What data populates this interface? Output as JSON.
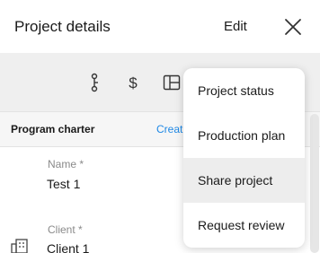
{
  "header": {
    "title": "Project details",
    "edit_label": "Edit",
    "close_icon": "close-icon"
  },
  "toolbar": {
    "icons": [
      "timeline-icon",
      "dollar-icon",
      "layout-icon"
    ]
  },
  "section": {
    "title": "Program charter",
    "link": "Creat"
  },
  "fields": [
    {
      "label": "Name *",
      "value": "Test 1"
    },
    {
      "label": "Client *",
      "value": "Client 1"
    }
  ],
  "menu": {
    "items": [
      "Project status",
      "Production plan",
      "Share project",
      "Request review"
    ],
    "active_item": "Share project"
  },
  "colors": {
    "link": "#1e88e5",
    "toolbar_bg": "#efefef",
    "menu_hover": "#ededed"
  }
}
